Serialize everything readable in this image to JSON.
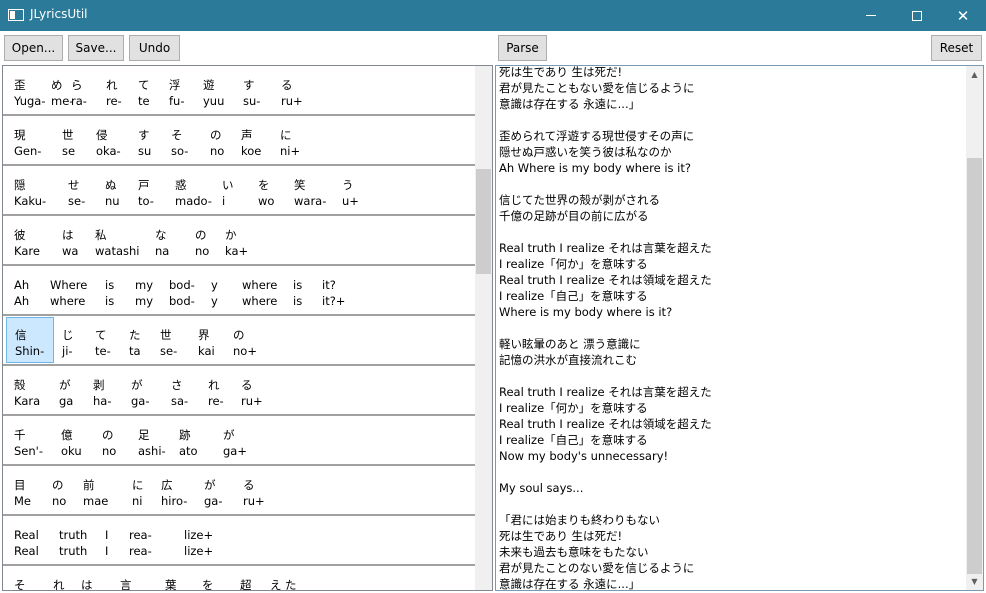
{
  "window": {
    "title": "JLyricsUtil",
    "minimize_glyph": "",
    "maximize_glyph": "",
    "close_glyph": "✕"
  },
  "toolbar": {
    "open_label": "Open...",
    "save_label": "Save...",
    "undo_label": "Undo",
    "parse_label": "Parse",
    "reset_label": "Reset"
  },
  "lyric_rows": [
    {
      "cells": [
        {
          "top": "歪",
          "bottom": "Yuga-"
        },
        {
          "top": "め",
          "bottom": "me-"
        },
        {
          "top": "ら",
          "bottom": "ra-"
        },
        {
          "top": "れ",
          "bottom": "re-"
        },
        {
          "top": "て",
          "bottom": "te"
        },
        {
          "top": "浮",
          "bottom": "fu-"
        },
        {
          "top": "遊",
          "bottom": "yuu"
        },
        {
          "top": "す",
          "bottom": "su-"
        },
        {
          "top": "る",
          "bottom": "ru+"
        }
      ]
    },
    {
      "cells": [
        {
          "top": "現",
          "bottom": "Gen-"
        },
        {
          "top": "世",
          "bottom": "se"
        },
        {
          "top": "侵",
          "bottom": "oka-"
        },
        {
          "top": "す",
          "bottom": "su"
        },
        {
          "top": "そ",
          "bottom": "so-"
        },
        {
          "top": "の",
          "bottom": "no"
        },
        {
          "top": "声",
          "bottom": "koe"
        },
        {
          "top": "に",
          "bottom": "ni+"
        }
      ]
    },
    {
      "cells": [
        {
          "top": "隠",
          "bottom": "Kaku-"
        },
        {
          "top": "せ",
          "bottom": "se-"
        },
        {
          "top": "ぬ",
          "bottom": "nu"
        },
        {
          "top": "戸",
          "bottom": "to-"
        },
        {
          "top": "惑",
          "bottom": "mado-"
        },
        {
          "top": "い",
          "bottom": "i"
        },
        {
          "top": "を",
          "bottom": "wo"
        },
        {
          "top": "笑",
          "bottom": "wara-"
        },
        {
          "top": "う",
          "bottom": "u+"
        }
      ]
    },
    {
      "cells": [
        {
          "top": "彼",
          "bottom": "Kare"
        },
        {
          "top": "は",
          "bottom": "wa"
        },
        {
          "top": "私",
          "bottom": "watashi"
        },
        {
          "top": "な",
          "bottom": "na"
        },
        {
          "top": "の",
          "bottom": "no"
        },
        {
          "top": "か",
          "bottom": "ka+"
        }
      ]
    },
    {
      "cells": [
        {
          "top": "Ah",
          "bottom": "Ah"
        },
        {
          "top": "Where",
          "bottom": "where"
        },
        {
          "top": "is",
          "bottom": "is"
        },
        {
          "top": "my",
          "bottom": "my"
        },
        {
          "top": "bod-",
          "bottom": "bod-"
        },
        {
          "top": "y",
          "bottom": "y"
        },
        {
          "top": "where",
          "bottom": "where"
        },
        {
          "top": "is",
          "bottom": "is"
        },
        {
          "top": "it?",
          "bottom": "it?+"
        }
      ]
    },
    {
      "cells": [
        {
          "top": "信",
          "bottom": "Shin-"
        },
        {
          "top": "じ",
          "bottom": "ji-"
        },
        {
          "top": "て",
          "bottom": "te-"
        },
        {
          "top": "た",
          "bottom": "ta"
        },
        {
          "top": "世",
          "bottom": "se-"
        },
        {
          "top": "界",
          "bottom": "kai"
        },
        {
          "top": "の",
          "bottom": "no+"
        }
      ]
    },
    {
      "cells": [
        {
          "top": "殻",
          "bottom": "Kara"
        },
        {
          "top": "が",
          "bottom": "ga"
        },
        {
          "top": "剥",
          "bottom": "ha-"
        },
        {
          "top": "が",
          "bottom": "ga-"
        },
        {
          "top": "さ",
          "bottom": "sa-"
        },
        {
          "top": "れ",
          "bottom": "re-"
        },
        {
          "top": "る",
          "bottom": "ru+"
        }
      ]
    },
    {
      "cells": [
        {
          "top": "千",
          "bottom": "Sen'-"
        },
        {
          "top": "億",
          "bottom": "oku"
        },
        {
          "top": "の",
          "bottom": "no"
        },
        {
          "top": "足",
          "bottom": "ashi-"
        },
        {
          "top": "跡",
          "bottom": "ato"
        },
        {
          "top": "が",
          "bottom": "ga+"
        }
      ]
    },
    {
      "cells": [
        {
          "top": "目",
          "bottom": "Me"
        },
        {
          "top": "の",
          "bottom": "no"
        },
        {
          "top": "前",
          "bottom": "mae"
        },
        {
          "top": "に",
          "bottom": "ni"
        },
        {
          "top": "広",
          "bottom": "hiro-"
        },
        {
          "top": "が",
          "bottom": "ga-"
        },
        {
          "top": "る",
          "bottom": "ru+"
        }
      ]
    },
    {
      "cells": [
        {
          "top": "Real",
          "bottom": "Real"
        },
        {
          "top": "truth",
          "bottom": "truth"
        },
        {
          "top": "I",
          "bottom": "I"
        },
        {
          "top": "rea-",
          "bottom": "rea-"
        },
        {
          "top": "lize+",
          "bottom": "lize+"
        }
      ]
    },
    {
      "cells": [
        {
          "top": "そ",
          "bottom": ""
        },
        {
          "top": "れ",
          "bottom": ""
        },
        {
          "top": "は",
          "bottom": ""
        },
        {
          "top": "言",
          "bottom": ""
        },
        {
          "top": "葉",
          "bottom": ""
        },
        {
          "top": "を",
          "bottom": ""
        },
        {
          "top": "超",
          "bottom": ""
        },
        {
          "top": "え",
          "bottom": ""
        },
        {
          "top": "た",
          "bottom": ""
        }
      ]
    }
  ],
  "lyrics_lines": [
    "死は生であり 生は死だ!",
    "君が見たこともない愛を信じるように",
    "意識は存在する 永遠に...」",
    "",
    "歪められて浮遊する現世侵すその声に",
    "隠せぬ戸惑いを笑う彼は私なのか",
    "Ah Where is my body where is it?",
    "",
    "信じてた世界の殻が剥がされる",
    "千億の足跡が目の前に広がる",
    "",
    "Real truth I realize それは言葉を超えた",
    "I realize「何か」を意味する",
    "Real truth I realize それは領域を超えた",
    "I realize「自己」を意味する",
    "Where is my body where is it?",
    "",
    "軽い眩暈のあと 漂う意識に",
    "記憶の洪水が直接流れこむ",
    "",
    "Real truth I realize それは言葉を超えた",
    "I realize「何か」を意味する",
    "Real truth I realize それは領域を超えた",
    "I realize「自己」を意味する",
    "Now my body's unnecessary!",
    "",
    "My soul says...",
    "",
    "「君には始まりも終わりもない",
    "死は生であり 生は死だ!",
    "未来も過去も意味をもたない",
    "君が見たことのない愛を信じるように",
    "意識は存在する 永遠に...」"
  ],
  "scroll": {
    "up_arrow": "▲",
    "down_arrow": "▼"
  }
}
